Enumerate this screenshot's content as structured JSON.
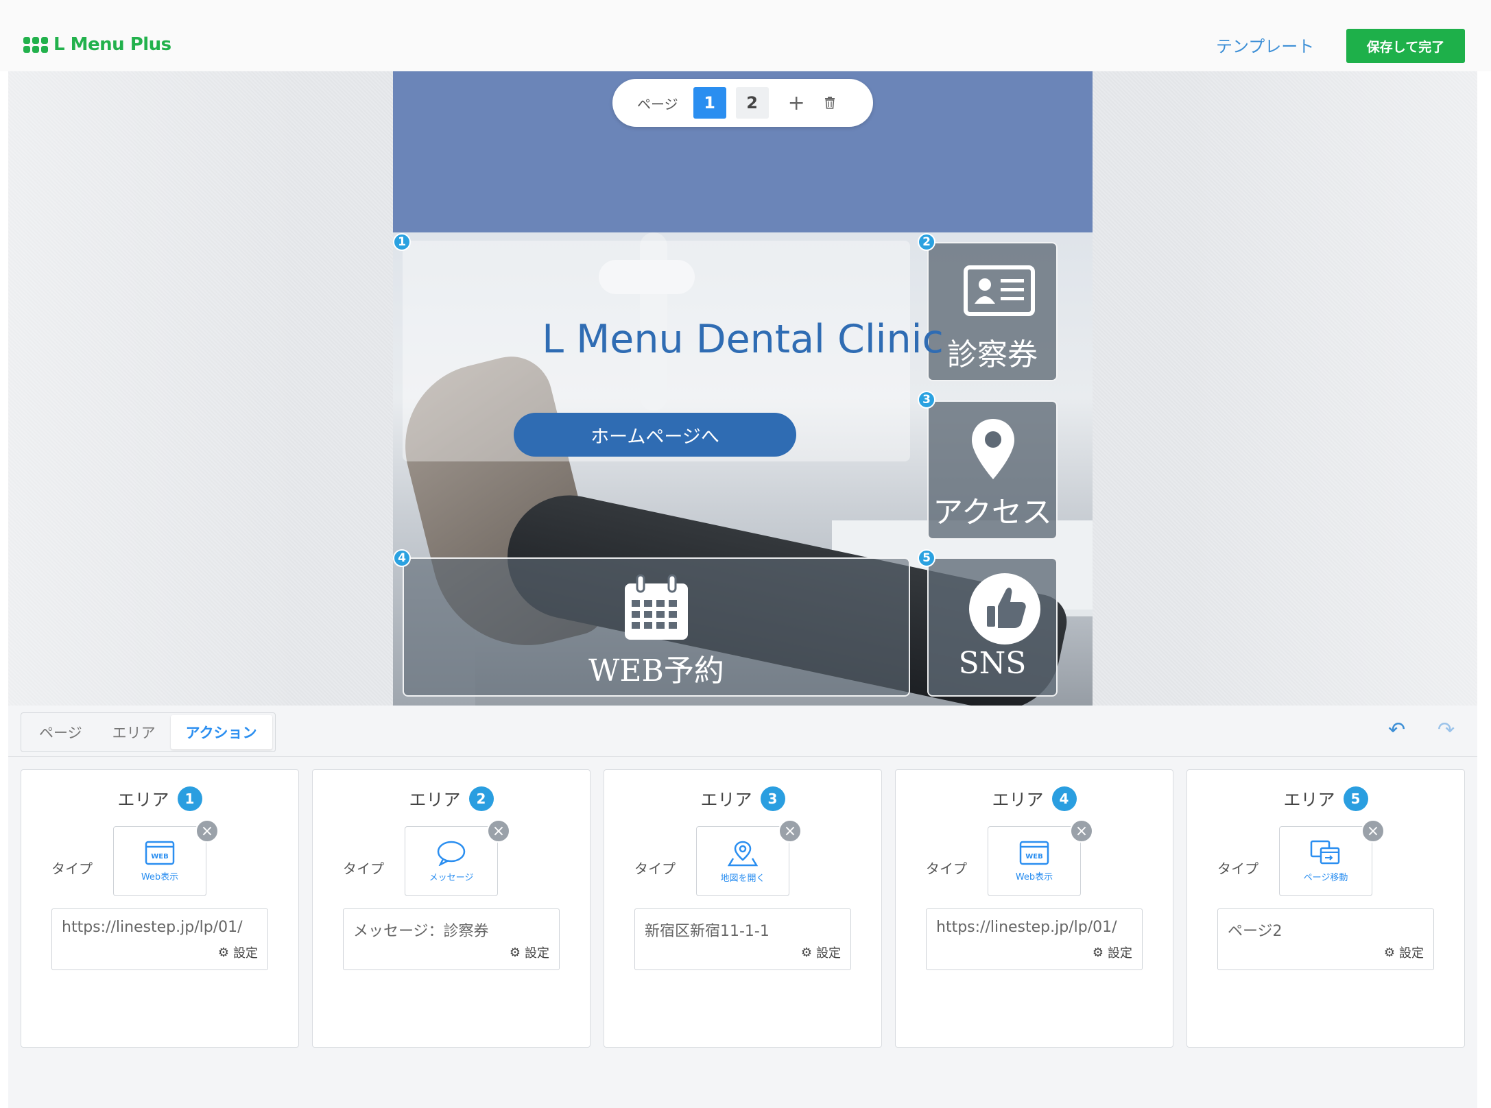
{
  "header": {
    "logo_text": "L Menu Plus",
    "template_link": "テンプレート",
    "save_button": "保存して完了",
    "brand_color": "#1eb04a"
  },
  "page_switcher": {
    "label": "ページ",
    "pages": [
      "1",
      "2"
    ],
    "active_page": "1",
    "add_icon": "+",
    "trash_icon": "trash-icon"
  },
  "menu": {
    "clinic_title": "L Menu Dental Clinic",
    "homepage_button": "ホームページへ",
    "areas": [
      {
        "number": "1"
      },
      {
        "number": "2",
        "label": "診察券",
        "icon": "id-card-icon"
      },
      {
        "number": "3",
        "label": "アクセス",
        "icon": "map-pin-icon"
      },
      {
        "number": "4",
        "label": "WEB予約",
        "icon": "calendar-icon"
      },
      {
        "number": "5",
        "label": "SNS",
        "icon": "thumbs-up-icon"
      }
    ]
  },
  "bottom": {
    "tabs": [
      "ページ",
      "エリア",
      "アクション"
    ],
    "active_tab": "アクション",
    "undo_icon": "↶",
    "redo_icon": "↷",
    "cards": [
      {
        "title": "エリア",
        "number": "1",
        "type_label": "タイプ",
        "type_name": "Web表示",
        "type_icon": "web-icon",
        "value": "https://linestep.jp/lp/01/",
        "setting": "設定"
      },
      {
        "title": "エリア",
        "number": "2",
        "type_label": "タイプ",
        "type_name": "メッセージ",
        "type_icon": "message-icon",
        "value": "メッセージ：診察券",
        "setting": "設定"
      },
      {
        "title": "エリア",
        "number": "3",
        "type_label": "タイプ",
        "type_name": "地図を開く",
        "type_icon": "map-icon",
        "value": "新宿区新宿11-1-1",
        "setting": "設定"
      },
      {
        "title": "エリア",
        "number": "4",
        "type_label": "タイプ",
        "type_name": "Web表示",
        "type_icon": "web-icon",
        "value": "https://linestep.jp/lp/01/",
        "setting": "設定"
      },
      {
        "title": "エリア",
        "number": "5",
        "type_label": "タイプ",
        "type_name": "ページ移動",
        "type_icon": "page-move-icon",
        "value": "ページ2",
        "setting": "設定"
      }
    ]
  }
}
